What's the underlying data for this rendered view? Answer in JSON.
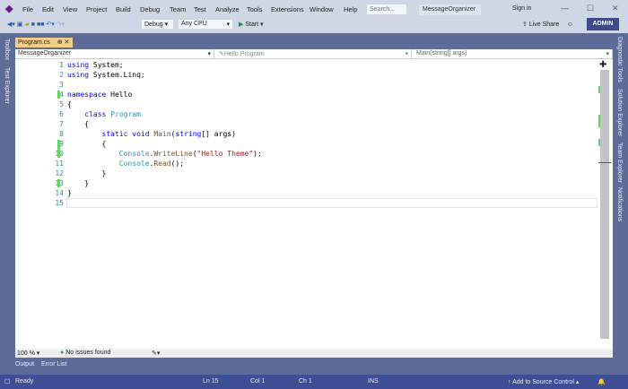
{
  "menu": [
    "File",
    "Edit",
    "View",
    "Project",
    "Build",
    "Debug",
    "Team",
    "Test",
    "Analyze",
    "Tools",
    "Extensions",
    "Window",
    "Help"
  ],
  "search_placeholder": "Search...",
  "project_name": "MessageOrganizer",
  "sign_in": "Sign in",
  "toolbar": {
    "config": "Debug",
    "platform": "Any CPU",
    "start": "Start",
    "live_share": "Live Share",
    "admin": "ADMIN"
  },
  "left_panels": [
    "Toolbox",
    "Test Explorer"
  ],
  "right_panels": [
    "Diagnostic Tools",
    "Solution Explorer",
    "Team Explorer",
    "Notifications"
  ],
  "tab": {
    "label": "Program.cs"
  },
  "nav": {
    "project": "MessageOrganizer",
    "class": "Hello.Program",
    "member": "Main(string[] args)"
  },
  "code_lines": [
    "1",
    "2",
    "3",
    "4",
    "5",
    "6",
    "7",
    "8",
    "9",
    "10",
    "11",
    "12",
    "13",
    "14",
    "15"
  ],
  "editor_status": {
    "zoom": "100 %",
    "issues": "No issues found"
  },
  "bottom_tabs": [
    "Output",
    "Error List"
  ],
  "status": {
    "ready": "Ready",
    "ln": "Ln 15",
    "col": "Col 1",
    "ch": "Ch 1",
    "mode": "INS",
    "source_control": "Add to Source Control"
  }
}
